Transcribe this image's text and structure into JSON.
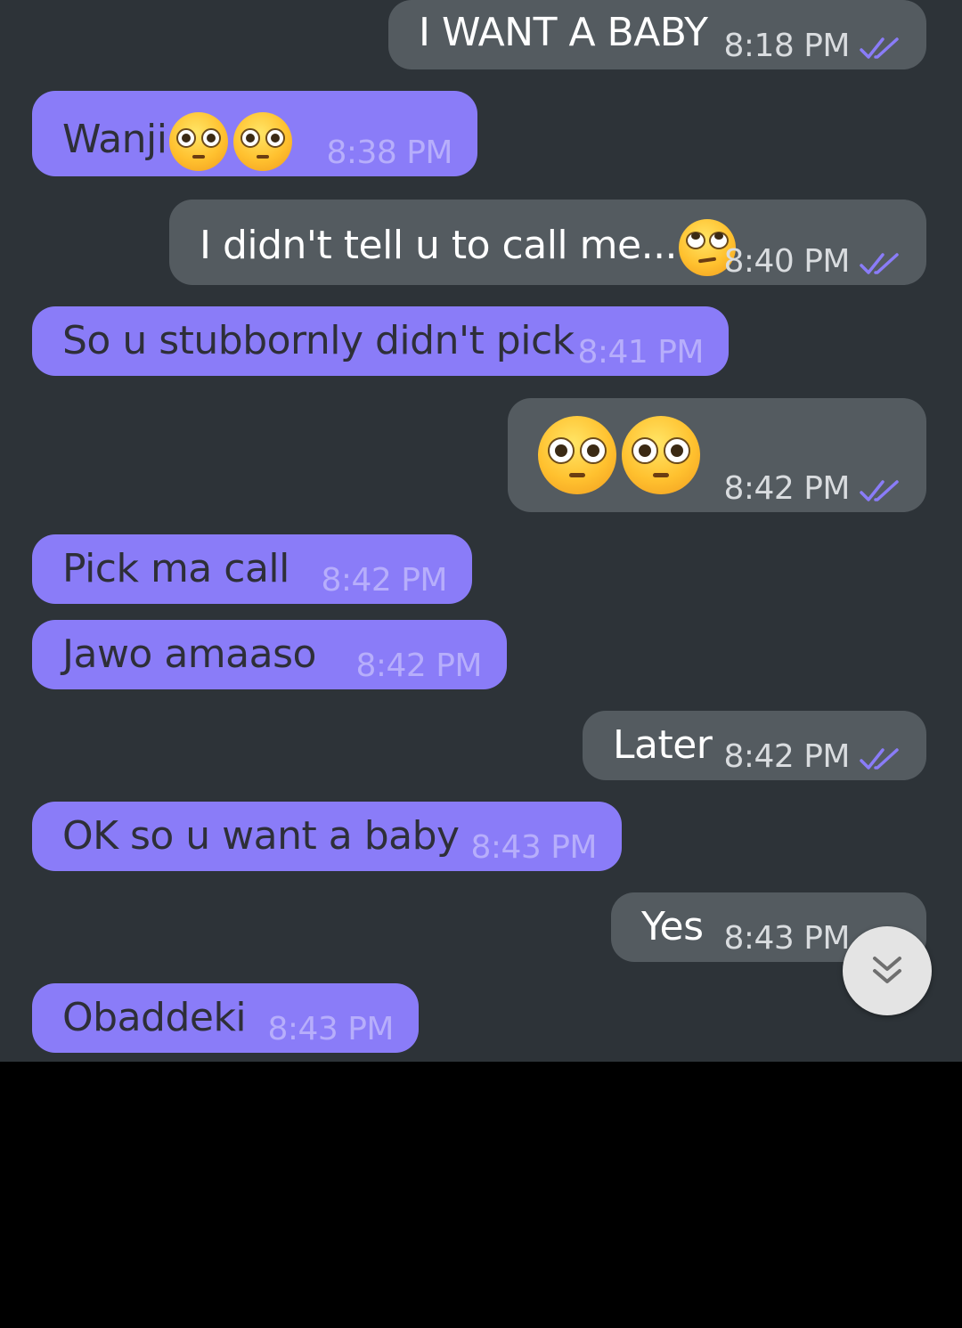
{
  "messages": [
    {
      "direction": "out",
      "text": "I WANT A BABY",
      "time": "8:18 PM",
      "status": "read"
    },
    {
      "direction": "in",
      "text": "Wanji",
      "emoji": [
        "flushed-face-emoji",
        "flushed-face-emoji"
      ],
      "time": "8:38 PM"
    },
    {
      "direction": "out",
      "text": "I didn't tell u to call me...",
      "emoji": [
        "face-with-rolling-eyes-emoji"
      ],
      "time": "8:40 PM",
      "status": "read"
    },
    {
      "direction": "in",
      "text": "So u stubbornly didn't pick",
      "time": "8:41 PM"
    },
    {
      "direction": "out",
      "text": "",
      "emoji": [
        "flushed-face-emoji",
        "flushed-face-emoji"
      ],
      "time": "8:42 PM",
      "status": "read"
    },
    {
      "direction": "in",
      "text": "Pick ma call",
      "time": "8:42 PM"
    },
    {
      "direction": "in",
      "text": "Jawo amaaso",
      "time": "8:42 PM"
    },
    {
      "direction": "out",
      "text": "Later",
      "time": "8:42 PM",
      "status": "read"
    },
    {
      "direction": "in",
      "text": "OK so u want a baby",
      "time": "8:43 PM"
    },
    {
      "direction": "out",
      "text": "Yes",
      "time": "8:43 PM",
      "status": "read"
    },
    {
      "direction": "in",
      "text": "Obaddeki",
      "time": "8:43 PM"
    }
  ],
  "scroll_button": {
    "icon": "chevron-double-down-icon"
  },
  "colors": {
    "background": "#2d3338",
    "incoming_bubble": "#8a7cf8",
    "outgoing_bubble": "#545b60",
    "read_check": "#8a7cf8"
  }
}
